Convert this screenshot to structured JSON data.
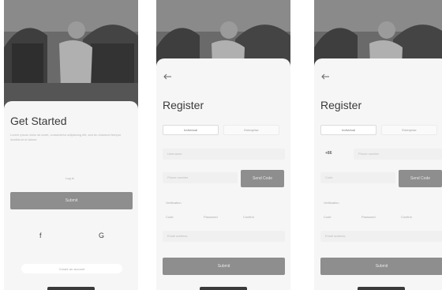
{
  "screen1": {
    "title": "Get Started",
    "description": "Lorem ipsum dolor sit amet, consectetur adipiscing elit, sed do eiusmod tempor incididunt ut labore",
    "login_hint": "Log in",
    "submit_label": "Submit",
    "facebook_icon": "f",
    "google_icon": "G",
    "register_link": "Create an account"
  },
  "screen2": {
    "title": "Register",
    "tab_individual": "Individual",
    "tab_enterprise": "Enterprise",
    "username_placeholder": "Username",
    "phone_placeholder": "Phone number",
    "send_code_label": "Send Code",
    "verification_label": "Verification",
    "code_hint_1": "Code",
    "code_hint_2": "Password",
    "code_hint_3": "Confirm",
    "email_placeholder": "Email address",
    "submit_label": "Submit"
  },
  "screen3": {
    "title": "Register",
    "tab_individual": "Individual",
    "tab_enterprise": "Enterprise",
    "country_code": "+86",
    "phone_placeholder": "Phone number",
    "code_placeholder": "Code",
    "send_code_label": "Send Code",
    "verification_label": "Verification",
    "code_hint_1": "Code",
    "code_hint_2": "Password",
    "code_hint_3": "Confirm",
    "email_placeholder": "Email address",
    "submit_label": "Submit"
  },
  "colors": {
    "button": "#8e8e8e",
    "background": "#f4f4f4",
    "text": "#3a3a3a"
  }
}
